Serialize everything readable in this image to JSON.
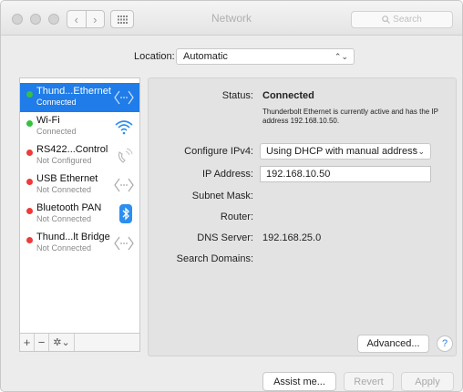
{
  "window": {
    "title": "Network"
  },
  "search": {
    "placeholder": "Search"
  },
  "location": {
    "label": "Location:",
    "value": "Automatic"
  },
  "services": [
    {
      "name": "Thund...Ethernet",
      "status": "Connected",
      "dot": "green",
      "icon": "ethernet-arrows-icon",
      "selected": true
    },
    {
      "name": "Wi-Fi",
      "status": "Connected",
      "dot": "green",
      "icon": "wifi-icon",
      "selected": false
    },
    {
      "name": "RS422...Control",
      "status": "Not Configured",
      "dot": "red",
      "icon": "phone-icon",
      "selected": false
    },
    {
      "name": "USB Ethernet",
      "status": "Not Connected",
      "dot": "red",
      "icon": "ethernet-arrows-icon",
      "selected": false
    },
    {
      "name": "Bluetooth PAN",
      "status": "Not Connected",
      "dot": "red",
      "icon": "bluetooth-icon",
      "selected": false
    },
    {
      "name": "Thund...lt Bridge",
      "status": "Not Connected",
      "dot": "red",
      "icon": "ethernet-arrows-icon",
      "selected": false
    }
  ],
  "sidebar_controls": {
    "add": "+",
    "remove": "−",
    "gear": "✲⌄"
  },
  "details": {
    "status_label": "Status:",
    "status_value": "Connected",
    "status_desc": "Thunderbolt Ethernet is currently active and has the IP address 192.168.10.50.",
    "configure_label": "Configure IPv4:",
    "configure_value": "Using DHCP with manual address",
    "ip_label": "IP Address:",
    "ip_value": "192.168.10.50",
    "subnet_label": "Subnet Mask:",
    "router_label": "Router:",
    "dns_label": "DNS Server:",
    "dns_value": "192.168.25.0",
    "search_domains_label": "Search Domains:"
  },
  "buttons": {
    "advanced": "Advanced...",
    "help": "?",
    "assist": "Assist me...",
    "revert": "Revert",
    "apply": "Apply"
  },
  "colors": {
    "selection": "#1f7ce8",
    "connected": "#35c141",
    "not_connected": "#ee3b3a",
    "accent_blue": "#2b8ef0"
  }
}
